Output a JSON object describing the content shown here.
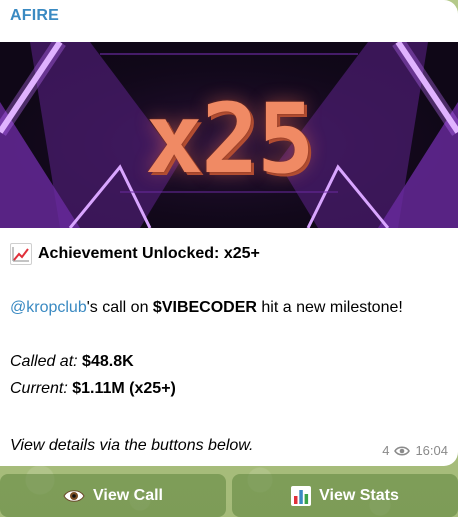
{
  "sender": "AFIRE",
  "banner": {
    "text": "x25"
  },
  "message": {
    "title": "Achievement Unlocked: x25+",
    "mention": "@kropclub",
    "line_mid": "'s call on ",
    "ticker": "$VIBECODER",
    "line_end": " hit a new milestone!",
    "called_label": "Called at:",
    "called_value": "$48.8K",
    "current_label": "Current:",
    "current_value": "$1.11M (x25+)",
    "details": "View details via the buttons below."
  },
  "meta": {
    "views": "4",
    "time": "16:04"
  },
  "buttons": {
    "view_call": "View Call",
    "view_stats": "View Stats"
  },
  "icons": {
    "title_icon": "chart-increasing-icon",
    "views_icon": "eye-icon",
    "view_call_icon": "eye-icon",
    "view_stats_icon": "bar-chart-icon"
  },
  "colors": {
    "sender": "#3a8ac2",
    "mention": "#3a8ac2",
    "banner_text": "#f08a64",
    "neon": "#b44bff",
    "button_bg": "#6f9446"
  }
}
